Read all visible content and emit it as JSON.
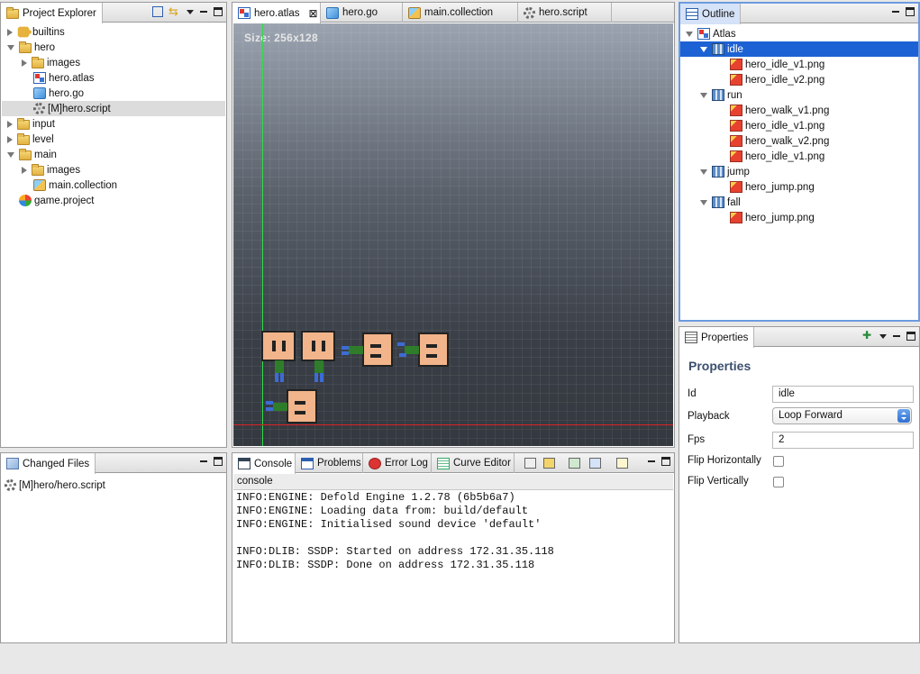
{
  "project_explorer": {
    "tab_label": "Project Explorer",
    "items": [
      {
        "label": "builtins",
        "icon": "puzzle-icon"
      },
      {
        "label": "hero",
        "icon": "folder-icon"
      },
      {
        "label": "images",
        "icon": "folder-icon"
      },
      {
        "label": "hero.atlas",
        "icon": "atlas-icon"
      },
      {
        "label": "hero.go",
        "icon": "game-object-icon"
      },
      {
        "label": "[M]hero.script",
        "icon": "script-gear-icon"
      },
      {
        "label": "input",
        "icon": "folder-icon"
      },
      {
        "label": "level",
        "icon": "folder-icon"
      },
      {
        "label": "main",
        "icon": "folder-icon"
      },
      {
        "label": "images",
        "icon": "folder-icon"
      },
      {
        "label": "main.collection",
        "icon": "collection-icon"
      },
      {
        "label": "game.project",
        "icon": "project-icon"
      }
    ]
  },
  "changed_files": {
    "tab_label": "Changed Files",
    "items": [
      {
        "label": "[M]hero/hero.script",
        "icon": "script-gear-icon"
      }
    ]
  },
  "editor": {
    "tabs": [
      {
        "label": "hero.atlas",
        "icon": "atlas-icon"
      },
      {
        "label": "hero.go",
        "icon": "game-object-icon"
      },
      {
        "label": "main.collection",
        "icon": "collection-icon"
      },
      {
        "label": "hero.script",
        "icon": "script-gear-icon"
      }
    ],
    "size_label": "Size: 256x128",
    "colors": {
      "y_axis": "#2ee04a",
      "x_axis": "#dd2222",
      "skin": "#f2b48a",
      "shirt": "#2f7d2a",
      "outline": "#222222"
    }
  },
  "console": {
    "tabs": [
      "Console",
      "Problems",
      "Error Log",
      "Curve Editor"
    ],
    "label": "console",
    "lines": [
      "INFO:ENGINE: Defold Engine 1.2.78 (6b5b6a7)",
      "INFO:ENGINE: Loading data from: build/default",
      "INFO:ENGINE: Initialised sound device 'default'",
      "",
      "INFO:DLIB: SSDP: Started on address 172.31.35.118",
      "INFO:DLIB: SSDP: Done on address 172.31.35.118"
    ]
  },
  "outline": {
    "tab_label": "Outline",
    "root": "Atlas",
    "animations": [
      {
        "id": "idle",
        "images": [
          "hero_idle_v1.png",
          "hero_idle_v2.png"
        ]
      },
      {
        "id": "run",
        "images": [
          "hero_walk_v1.png",
          "hero_idle_v1.png",
          "hero_walk_v2.png",
          "hero_idle_v1.png"
        ]
      },
      {
        "id": "jump",
        "images": [
          "hero_jump.png"
        ]
      },
      {
        "id": "fall",
        "images": [
          "hero_jump.png"
        ]
      }
    ]
  },
  "properties": {
    "tab_label": "Properties",
    "title": "Properties",
    "id_label": "Id",
    "id_value": "idle",
    "playback_label": "Playback",
    "playback_value": "Loop Forward",
    "fps_label": "Fps",
    "fps_value": "2",
    "flip_h_label": "Flip Horizontally",
    "flip_h_checked": false,
    "flip_v_label": "Flip Vertically",
    "flip_v_checked": false
  }
}
